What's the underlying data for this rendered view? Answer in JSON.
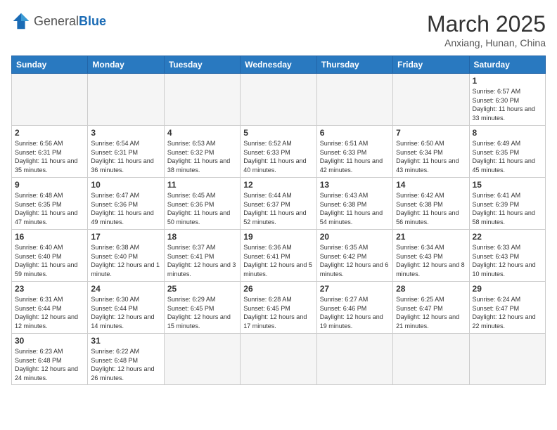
{
  "header": {
    "logo_general": "General",
    "logo_blue": "Blue",
    "month": "March 2025",
    "location": "Anxiang, Hunan, China"
  },
  "weekdays": [
    "Sunday",
    "Monday",
    "Tuesday",
    "Wednesday",
    "Thursday",
    "Friday",
    "Saturday"
  ],
  "weeks": [
    [
      {
        "day": "",
        "sunrise": "",
        "sunset": "",
        "daylight": "",
        "empty": true
      },
      {
        "day": "",
        "sunrise": "",
        "sunset": "",
        "daylight": "",
        "empty": true
      },
      {
        "day": "",
        "sunrise": "",
        "sunset": "",
        "daylight": "",
        "empty": true
      },
      {
        "day": "",
        "sunrise": "",
        "sunset": "",
        "daylight": "",
        "empty": true
      },
      {
        "day": "",
        "sunrise": "",
        "sunset": "",
        "daylight": "",
        "empty": true
      },
      {
        "day": "",
        "sunrise": "",
        "sunset": "",
        "daylight": "",
        "empty": true
      },
      {
        "day": "1",
        "sunrise": "Sunrise: 6:57 AM",
        "sunset": "Sunset: 6:30 PM",
        "daylight": "Daylight: 11 hours and 33 minutes.",
        "empty": false
      }
    ],
    [
      {
        "day": "2",
        "sunrise": "Sunrise: 6:56 AM",
        "sunset": "Sunset: 6:31 PM",
        "daylight": "Daylight: 11 hours and 35 minutes.",
        "empty": false
      },
      {
        "day": "3",
        "sunrise": "Sunrise: 6:54 AM",
        "sunset": "Sunset: 6:31 PM",
        "daylight": "Daylight: 11 hours and 36 minutes.",
        "empty": false
      },
      {
        "day": "4",
        "sunrise": "Sunrise: 6:53 AM",
        "sunset": "Sunset: 6:32 PM",
        "daylight": "Daylight: 11 hours and 38 minutes.",
        "empty": false
      },
      {
        "day": "5",
        "sunrise": "Sunrise: 6:52 AM",
        "sunset": "Sunset: 6:33 PM",
        "daylight": "Daylight: 11 hours and 40 minutes.",
        "empty": false
      },
      {
        "day": "6",
        "sunrise": "Sunrise: 6:51 AM",
        "sunset": "Sunset: 6:33 PM",
        "daylight": "Daylight: 11 hours and 42 minutes.",
        "empty": false
      },
      {
        "day": "7",
        "sunrise": "Sunrise: 6:50 AM",
        "sunset": "Sunset: 6:34 PM",
        "daylight": "Daylight: 11 hours and 43 minutes.",
        "empty": false
      },
      {
        "day": "8",
        "sunrise": "Sunrise: 6:49 AM",
        "sunset": "Sunset: 6:35 PM",
        "daylight": "Daylight: 11 hours and 45 minutes.",
        "empty": false
      }
    ],
    [
      {
        "day": "9",
        "sunrise": "Sunrise: 6:48 AM",
        "sunset": "Sunset: 6:35 PM",
        "daylight": "Daylight: 11 hours and 47 minutes.",
        "empty": false
      },
      {
        "day": "10",
        "sunrise": "Sunrise: 6:47 AM",
        "sunset": "Sunset: 6:36 PM",
        "daylight": "Daylight: 11 hours and 49 minutes.",
        "empty": false
      },
      {
        "day": "11",
        "sunrise": "Sunrise: 6:45 AM",
        "sunset": "Sunset: 6:36 PM",
        "daylight": "Daylight: 11 hours and 50 minutes.",
        "empty": false
      },
      {
        "day": "12",
        "sunrise": "Sunrise: 6:44 AM",
        "sunset": "Sunset: 6:37 PM",
        "daylight": "Daylight: 11 hours and 52 minutes.",
        "empty": false
      },
      {
        "day": "13",
        "sunrise": "Sunrise: 6:43 AM",
        "sunset": "Sunset: 6:38 PM",
        "daylight": "Daylight: 11 hours and 54 minutes.",
        "empty": false
      },
      {
        "day": "14",
        "sunrise": "Sunrise: 6:42 AM",
        "sunset": "Sunset: 6:38 PM",
        "daylight": "Daylight: 11 hours and 56 minutes.",
        "empty": false
      },
      {
        "day": "15",
        "sunrise": "Sunrise: 6:41 AM",
        "sunset": "Sunset: 6:39 PM",
        "daylight": "Daylight: 11 hours and 58 minutes.",
        "empty": false
      }
    ],
    [
      {
        "day": "16",
        "sunrise": "Sunrise: 6:40 AM",
        "sunset": "Sunset: 6:40 PM",
        "daylight": "Daylight: 11 hours and 59 minutes.",
        "empty": false
      },
      {
        "day": "17",
        "sunrise": "Sunrise: 6:38 AM",
        "sunset": "Sunset: 6:40 PM",
        "daylight": "Daylight: 12 hours and 1 minute.",
        "empty": false
      },
      {
        "day": "18",
        "sunrise": "Sunrise: 6:37 AM",
        "sunset": "Sunset: 6:41 PM",
        "daylight": "Daylight: 12 hours and 3 minutes.",
        "empty": false
      },
      {
        "day": "19",
        "sunrise": "Sunrise: 6:36 AM",
        "sunset": "Sunset: 6:41 PM",
        "daylight": "Daylight: 12 hours and 5 minutes.",
        "empty": false
      },
      {
        "day": "20",
        "sunrise": "Sunrise: 6:35 AM",
        "sunset": "Sunset: 6:42 PM",
        "daylight": "Daylight: 12 hours and 6 minutes.",
        "empty": false
      },
      {
        "day": "21",
        "sunrise": "Sunrise: 6:34 AM",
        "sunset": "Sunset: 6:43 PM",
        "daylight": "Daylight: 12 hours and 8 minutes.",
        "empty": false
      },
      {
        "day": "22",
        "sunrise": "Sunrise: 6:33 AM",
        "sunset": "Sunset: 6:43 PM",
        "daylight": "Daylight: 12 hours and 10 minutes.",
        "empty": false
      }
    ],
    [
      {
        "day": "23",
        "sunrise": "Sunrise: 6:31 AM",
        "sunset": "Sunset: 6:44 PM",
        "daylight": "Daylight: 12 hours and 12 minutes.",
        "empty": false
      },
      {
        "day": "24",
        "sunrise": "Sunrise: 6:30 AM",
        "sunset": "Sunset: 6:44 PM",
        "daylight": "Daylight: 12 hours and 14 minutes.",
        "empty": false
      },
      {
        "day": "25",
        "sunrise": "Sunrise: 6:29 AM",
        "sunset": "Sunset: 6:45 PM",
        "daylight": "Daylight: 12 hours and 15 minutes.",
        "empty": false
      },
      {
        "day": "26",
        "sunrise": "Sunrise: 6:28 AM",
        "sunset": "Sunset: 6:45 PM",
        "daylight": "Daylight: 12 hours and 17 minutes.",
        "empty": false
      },
      {
        "day": "27",
        "sunrise": "Sunrise: 6:27 AM",
        "sunset": "Sunset: 6:46 PM",
        "daylight": "Daylight: 12 hours and 19 minutes.",
        "empty": false
      },
      {
        "day": "28",
        "sunrise": "Sunrise: 6:25 AM",
        "sunset": "Sunset: 6:47 PM",
        "daylight": "Daylight: 12 hours and 21 minutes.",
        "empty": false
      },
      {
        "day": "29",
        "sunrise": "Sunrise: 6:24 AM",
        "sunset": "Sunset: 6:47 PM",
        "daylight": "Daylight: 12 hours and 22 minutes.",
        "empty": false
      }
    ],
    [
      {
        "day": "30",
        "sunrise": "Sunrise: 6:23 AM",
        "sunset": "Sunset: 6:48 PM",
        "daylight": "Daylight: 12 hours and 24 minutes.",
        "empty": false
      },
      {
        "day": "31",
        "sunrise": "Sunrise: 6:22 AM",
        "sunset": "Sunset: 6:48 PM",
        "daylight": "Daylight: 12 hours and 26 minutes.",
        "empty": false
      },
      {
        "day": "",
        "sunrise": "",
        "sunset": "",
        "daylight": "",
        "empty": true
      },
      {
        "day": "",
        "sunrise": "",
        "sunset": "",
        "daylight": "",
        "empty": true
      },
      {
        "day": "",
        "sunrise": "",
        "sunset": "",
        "daylight": "",
        "empty": true
      },
      {
        "day": "",
        "sunrise": "",
        "sunset": "",
        "daylight": "",
        "empty": true
      },
      {
        "day": "",
        "sunrise": "",
        "sunset": "",
        "daylight": "",
        "empty": true
      }
    ]
  ]
}
